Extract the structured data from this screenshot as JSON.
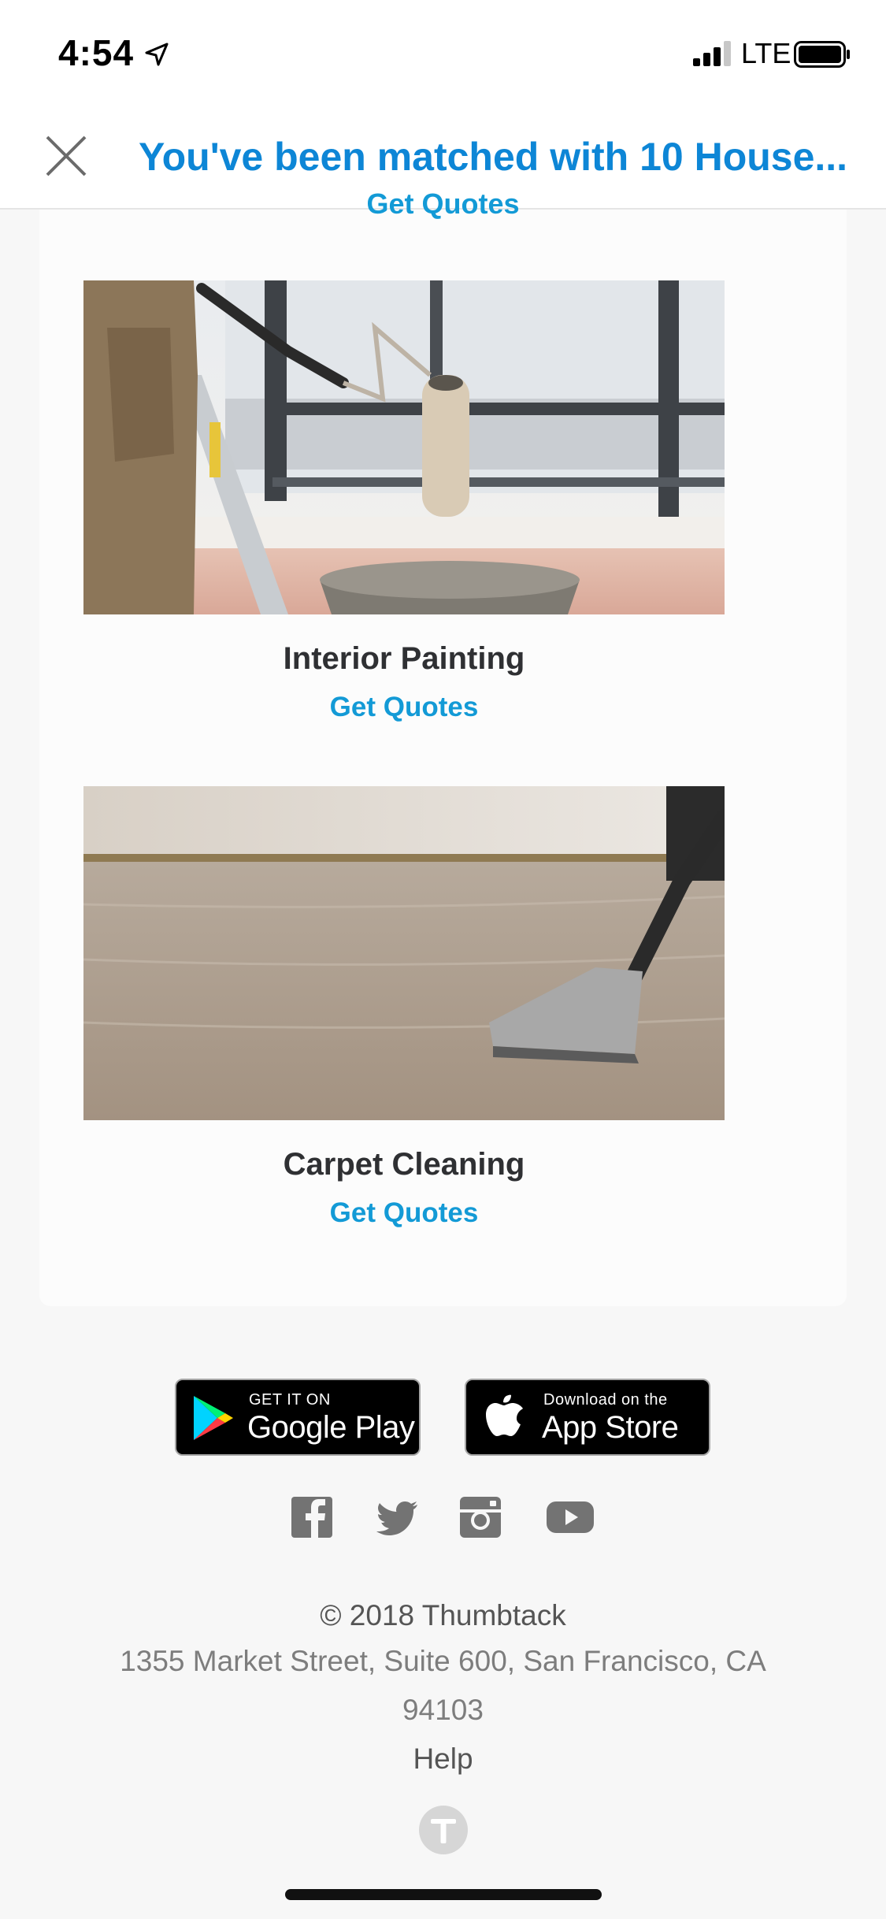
{
  "status_bar": {
    "time": "4:54",
    "network": "LTE"
  },
  "header": {
    "title": "You've been matched with 10 House...",
    "close_icon": "close-icon"
  },
  "services": {
    "previous_link": "Get Quotes",
    "items": [
      {
        "title": "Interior Painting",
        "link": "Get Quotes"
      },
      {
        "title": "Carpet Cleaning",
        "link": "Get Quotes"
      }
    ]
  },
  "app_badges": {
    "google": {
      "small": "GET IT ON",
      "big": "Google Play"
    },
    "apple": {
      "small": "Download on the",
      "big": "App Store"
    }
  },
  "social": [
    "facebook-icon",
    "twitter-icon",
    "instagram-icon",
    "youtube-icon"
  ],
  "footer": {
    "copyright": "© 2018 Thumbtack",
    "address_line1": "1355 Market Street, Suite 600, San Francisco, CA",
    "address_line2": "94103",
    "help": "Help"
  },
  "colors": {
    "accent": "#0d86d6",
    "link": "#139ad6",
    "footer_text": "#7d7d7d"
  }
}
